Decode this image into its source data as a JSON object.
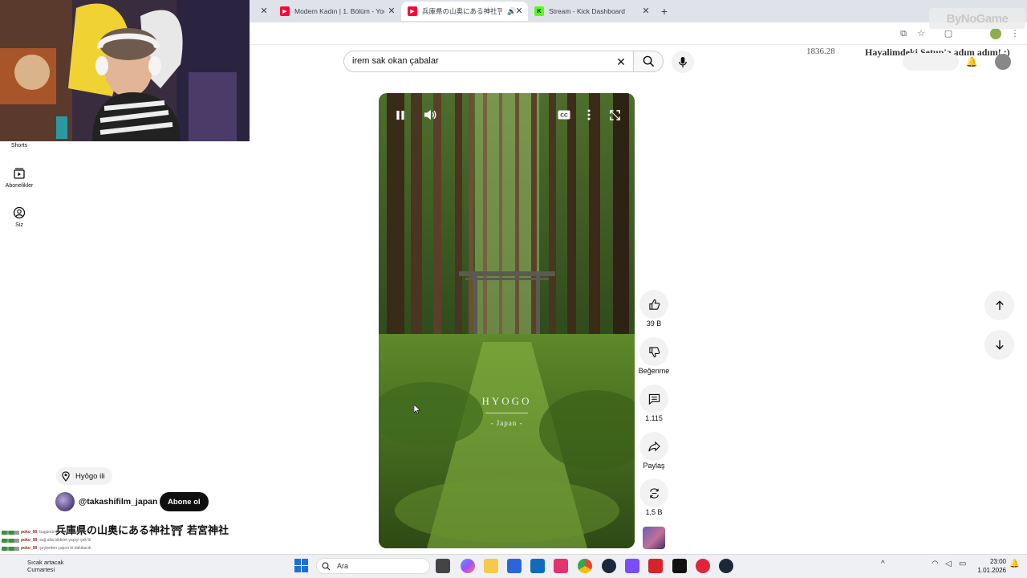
{
  "browser": {
    "tabs": [
      {
        "title": "Modern Kadın | 1. Bölüm - You",
        "active": false
      },
      {
        "title": "兵庫県の山奥にある神社⛩",
        "active": true
      },
      {
        "title": "Stream - Kick Dashboard",
        "active": false
      }
    ],
    "new_tab": "+"
  },
  "overlay": {
    "watermark": "ByNoGame",
    "timer": "1836.28",
    "goal": "Hayalimdeki Setup'a adım adım! :)"
  },
  "sidebar": {
    "items": [
      {
        "label": "Shorts",
        "icon": "shorts-icon"
      },
      {
        "label": "Abonelikler",
        "icon": "subscriptions-icon"
      },
      {
        "label": "Siz",
        "icon": "you-icon"
      }
    ]
  },
  "search": {
    "value": "irem sak okan çabalar"
  },
  "video": {
    "caption_title": "HYOGO",
    "caption_sub": "- Japan -",
    "controls": [
      "pause-icon",
      "volume-icon",
      "cc-icon",
      "more-icon",
      "fullscreen-icon"
    ]
  },
  "actions": {
    "like_count": "39 B",
    "dislike_label": "Beğenme",
    "comment_count": "1.115",
    "share_label": "Paylaş",
    "remix_count": "1,5 B"
  },
  "info": {
    "location": "Hyōgo ili",
    "channel": "@takashifilm_japan",
    "subscribe": "Abone ol",
    "title": "兵庫県の山奥にある神社⛩ 若宮神社"
  },
  "chat": [
    {
      "user": "poko_90",
      "text": "bugünün temel günleri"
    },
    {
      "user": "poko_90",
      "text": "sağ alta bildirim yapıyı çek bi"
    },
    {
      "user": "poko_90",
      "text": "şeylerden çapını bi dakikacık"
    },
    {
      "user": "poko_90",
      "text": "..."
    },
    {
      "user": "poko_90",
      "text": "..."
    },
    {
      "user": "poko_90",
      "text": "..."
    }
  ],
  "taskbar": {
    "search_placeholder": "Ara",
    "widget_line1": "Sıcak artacak",
    "widget_line2": "Cumartesi",
    "time": "23:00",
    "date": "1.01.2026"
  },
  "colors": {
    "youtube_red": "#ff0033",
    "kick_green": "#53fc18",
    "surface": "#f2f2f2"
  }
}
